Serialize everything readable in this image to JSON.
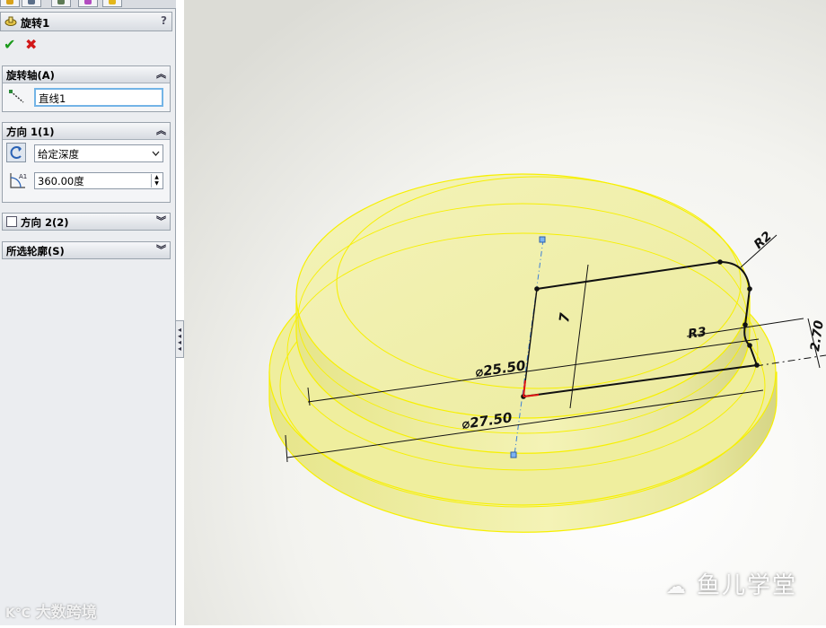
{
  "feature": {
    "title": "旋转1",
    "help": "?",
    "ok_glyph": "✔",
    "cancel_glyph": "✖"
  },
  "axis_section": {
    "header": "旋转轴(A)",
    "value": "直线1"
  },
  "direction1": {
    "header": "方向 1(1)",
    "end_condition": "给定深度",
    "angle": "360.00度"
  },
  "direction2": {
    "header": "方向 2(2)",
    "checked": false
  },
  "contours": {
    "header": "所选轮廓(S)"
  },
  "sketch_dims": {
    "d1": "⌀25.50",
    "d2": "⌀27.50",
    "height": "7",
    "r_small": "R2",
    "r_big": "R3",
    "step": "2.70"
  },
  "watermarks": {
    "left": "大数跨境",
    "right": "鱼儿学堂"
  },
  "colors": {
    "part_fill": "#f2f1a6",
    "edge_yellow": "#f7f000",
    "ok_green": "#1a9a1a",
    "cancel_red": "#d21818"
  }
}
